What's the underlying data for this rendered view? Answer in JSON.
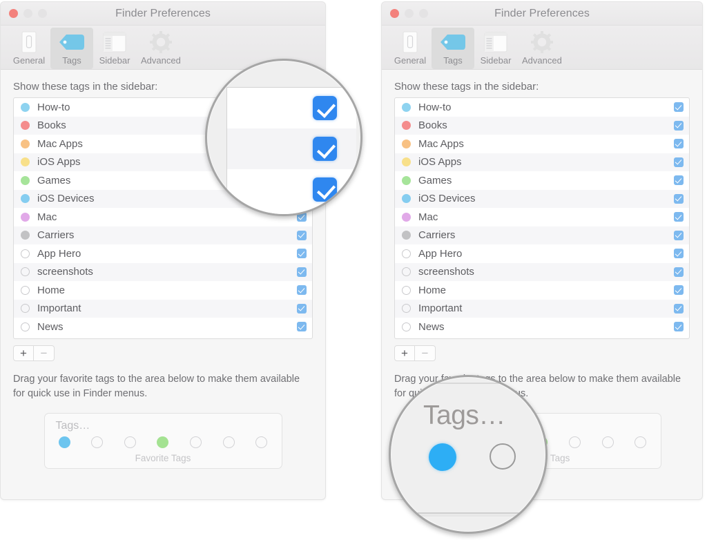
{
  "windows": [
    {
      "id": "left",
      "title": "Finder Preferences",
      "traffic_lights": [
        "close",
        "minimize",
        "zoom"
      ],
      "toolbar": {
        "items": [
          {
            "label": "General",
            "icon": "general-icon",
            "active": false
          },
          {
            "label": "Tags",
            "icon": "tag-icon",
            "active": true
          },
          {
            "label": "Sidebar",
            "icon": "sidebar-icon",
            "active": false
          },
          {
            "label": "Advanced",
            "icon": "gear-icon",
            "active": false
          }
        ]
      },
      "section_label": "Show these tags in the sidebar:",
      "tags": [
        {
          "name": "How-to",
          "color": "#8ed3f0",
          "checked": true
        },
        {
          "name": "Books",
          "color": "#f48c8c",
          "checked": true
        },
        {
          "name": "Mac Apps",
          "color": "#f8c183",
          "checked": true
        },
        {
          "name": "iOS Apps",
          "color": "#f8e08a",
          "checked": true
        },
        {
          "name": "Games",
          "color": "#a6e49a",
          "checked": true
        },
        {
          "name": "iOS Devices",
          "color": "#85cdf0",
          "checked": true
        },
        {
          "name": "Mac",
          "color": "#e1a9e8",
          "checked": true
        },
        {
          "name": "Carriers",
          "color": "#c2c2c4",
          "checked": true
        },
        {
          "name": "App Hero",
          "color": "hollow",
          "checked": true
        },
        {
          "name": "screenshots",
          "color": "hollow",
          "checked": true
        },
        {
          "name": "Home",
          "color": "hollow",
          "checked": true
        },
        {
          "name": "Important",
          "color": "hollow",
          "checked": true
        },
        {
          "name": "News",
          "color": "hollow",
          "checked": true
        }
      ],
      "add_button": "+",
      "remove_button": "−",
      "help_text": "Drag your favorite tags to the area below to make them available for quick use in Finder menus.",
      "favorites": {
        "title": "Tags…",
        "caption": "Favorite Tags",
        "slots": [
          {
            "color": "#6dc5ef",
            "filled": true
          },
          {
            "color": "hollow",
            "filled": false
          },
          {
            "color": "hollow",
            "filled": false
          },
          {
            "color": "#a4e292",
            "filled": true
          },
          {
            "color": "hollow",
            "filled": false
          },
          {
            "color": "hollow",
            "filled": false
          },
          {
            "color": "hollow",
            "filled": false
          }
        ]
      }
    },
    {
      "id": "right",
      "title": "Finder Preferences",
      "traffic_lights": [
        "close",
        "minimize",
        "zoom"
      ],
      "toolbar": {
        "items": [
          {
            "label": "General",
            "icon": "general-icon",
            "active": false
          },
          {
            "label": "Tags",
            "icon": "tag-icon",
            "active": true
          },
          {
            "label": "Sidebar",
            "icon": "sidebar-icon",
            "active": false
          },
          {
            "label": "Advanced",
            "icon": "gear-icon",
            "active": false
          }
        ]
      },
      "section_label": "Show these tags in the sidebar:",
      "tags": [
        {
          "name": "How-to",
          "color": "#8ed3f0",
          "checked": true
        },
        {
          "name": "Books",
          "color": "#f48c8c",
          "checked": true
        },
        {
          "name": "Mac Apps",
          "color": "#f8c183",
          "checked": true
        },
        {
          "name": "iOS Apps",
          "color": "#f8e08a",
          "checked": true
        },
        {
          "name": "Games",
          "color": "#a6e49a",
          "checked": true
        },
        {
          "name": "iOS Devices",
          "color": "#85cdf0",
          "checked": true
        },
        {
          "name": "Mac",
          "color": "#e1a9e8",
          "checked": true
        },
        {
          "name": "Carriers",
          "color": "#c2c2c4",
          "checked": true
        },
        {
          "name": "App Hero",
          "color": "hollow",
          "checked": true
        },
        {
          "name": "screenshots",
          "color": "hollow",
          "checked": true
        },
        {
          "name": "Home",
          "color": "hollow",
          "checked": true
        },
        {
          "name": "Important",
          "color": "hollow",
          "checked": true
        },
        {
          "name": "News",
          "color": "hollow",
          "checked": true
        }
      ],
      "add_button": "+",
      "remove_button": "−",
      "help_text": "Drag your favorite tags to the area below to make them available for quick use in Finder menus.",
      "favorites": {
        "title": "Tags…",
        "caption": "Favorite Tags",
        "slots": [
          {
            "color": "#6dc5ef",
            "filled": true
          },
          {
            "color": "hollow",
            "filled": false
          },
          {
            "color": "hollow",
            "filled": false
          },
          {
            "color": "#a4e292",
            "filled": true
          },
          {
            "color": "hollow",
            "filled": false
          },
          {
            "color": "hollow",
            "filled": false
          },
          {
            "color": "hollow",
            "filled": false
          }
        ]
      }
    }
  ],
  "loupes": [
    {
      "id": "left-loupe",
      "target": "tag-checkboxes",
      "checkbox_count": 3,
      "checkbox_color": "#2f87ef"
    },
    {
      "id": "right-loupe",
      "target": "favorite-tags-slots",
      "title": "Tags…",
      "filled_dot_color": "#2daef5",
      "hollow_dot_outline": "#9a9a9a"
    }
  ]
}
